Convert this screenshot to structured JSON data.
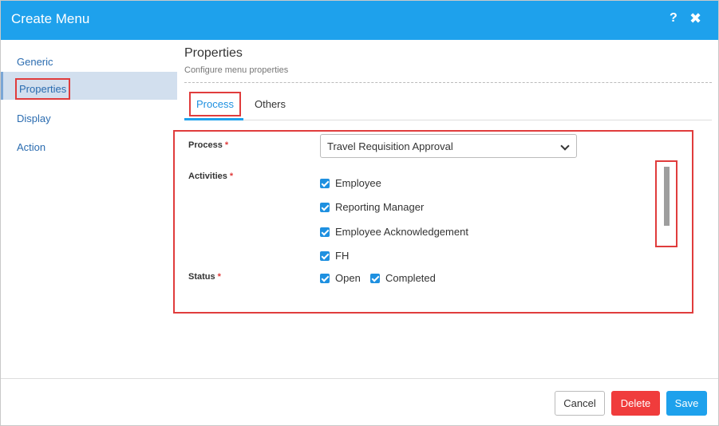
{
  "dialog": {
    "title": "Create Menu",
    "help_icon": "?",
    "close_icon": "✖"
  },
  "sidebar": {
    "items": [
      {
        "label": "Generic"
      },
      {
        "label": "Properties"
      },
      {
        "label": "Display"
      },
      {
        "label": "Action"
      }
    ],
    "active": "Properties"
  },
  "content": {
    "heading": "Properties",
    "subheading": "Configure menu properties"
  },
  "tabs": [
    {
      "label": "Process"
    },
    {
      "label": "Others"
    }
  ],
  "form": {
    "process_label": "Process",
    "process_value": "Travel Requisition Approval",
    "activities_label": "Activities",
    "activities": [
      {
        "label": "Employee",
        "checked": true
      },
      {
        "label": "Reporting Manager",
        "checked": true
      },
      {
        "label": "Employee Acknowledgement",
        "checked": true
      },
      {
        "label": "FH",
        "checked": true
      }
    ],
    "status_label": "Status",
    "status": [
      {
        "label": "Open",
        "checked": true
      },
      {
        "label": "Completed",
        "checked": true
      }
    ],
    "required_mark": "*"
  },
  "footer": {
    "cancel_label": "Cancel",
    "delete_label": "Delete",
    "save_label": "Save"
  },
  "colors": {
    "header": "#1ea1ec",
    "delete": "#f03c3c",
    "highlight": "#e03c3c",
    "sidebar_active": "#d2dfee"
  }
}
